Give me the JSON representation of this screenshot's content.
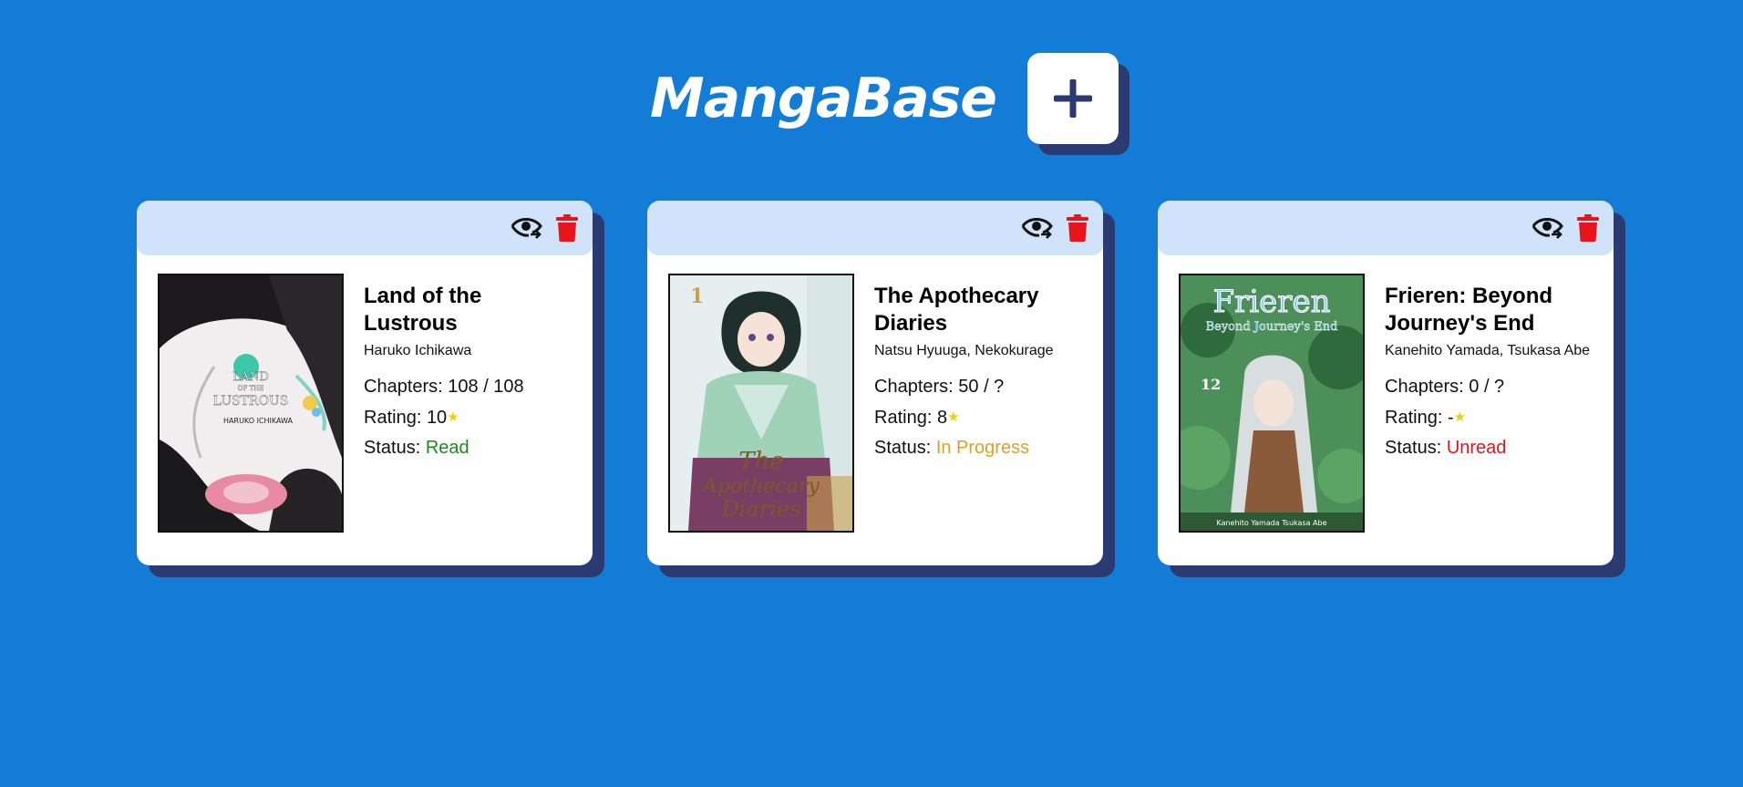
{
  "app": {
    "title": "MangaBase",
    "add_icon": "plus-icon",
    "colors": {
      "background": "#127cd6",
      "card_header": "#d0e3fb",
      "shadow": "#2c3a72",
      "delete": "#e8141c",
      "star": "#f5d000"
    }
  },
  "labels": {
    "chapters": "Chapters: ",
    "rating": "Rating: ",
    "status": "Status: "
  },
  "manga": [
    {
      "title": "Land of the Lustrous",
      "authors": "Haruko Ichikawa",
      "chapters": "108 / 108",
      "rating": "10",
      "status": "Read",
      "status_color": "#1a8a1a",
      "cover_title": "LAND OF THE LUSTROUS",
      "cover_author": "HARUKO ICHIKAWA"
    },
    {
      "title": "The Apothecary Diaries",
      "authors": "Natsu Hyuuga, Nekokurage",
      "chapters": "50 / ?",
      "rating": "8",
      "status": "In Progress",
      "status_color": "#dba02a",
      "cover_title": "The Apothecary Diaries",
      "cover_volume": "1"
    },
    {
      "title": "Frieren: Beyond Journey's End",
      "authors": "Kanehito Yamada, Tsukasa Abe",
      "chapters": "0 / ?",
      "rating": "-",
      "status": "Unread",
      "status_color": "#e0151c",
      "cover_title": "Frieren",
      "cover_subtitle": "Beyond Journey's End",
      "cover_volume": "12",
      "cover_credits": "Kanehito Yamada   Tsukasa Abe"
    }
  ]
}
